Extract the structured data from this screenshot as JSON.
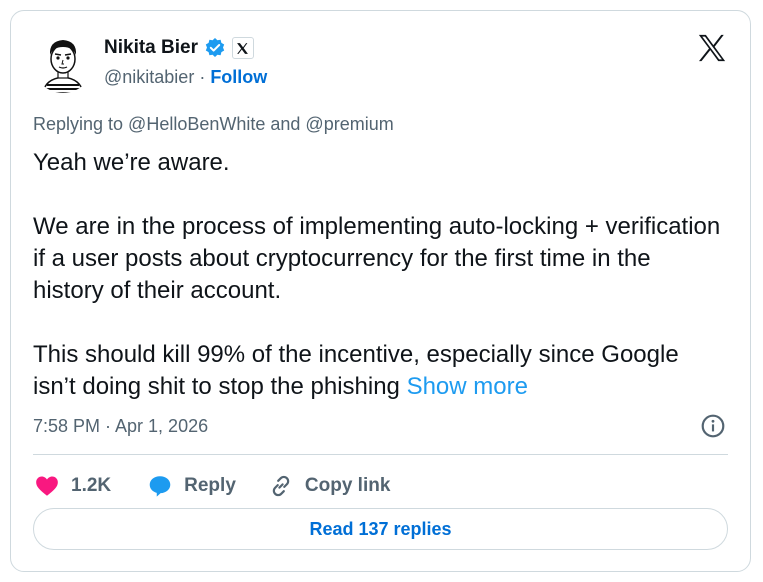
{
  "author": {
    "name": "Nikita Bier",
    "handle": "@nikitabier",
    "follow_label": "Follow",
    "separator": "·",
    "avatar_icon": "cartoon-portrait-avatar",
    "verified_icon": "verified-badge-icon",
    "affiliation_icon": "x-affiliation-badge-icon"
  },
  "header": {
    "logo_icon": "x-logo-icon"
  },
  "tweet": {
    "reply_to": "Replying to @HelloBenWhite and @premium",
    "paragraphs": [
      "Yeah we’re aware.",
      "We are in the process of implementing auto-locking + verification if a user posts about cryptocurrency for the first time in the history of their account.",
      "This should kill 99% of the incentive, especially since Google isn’t doing shit to stop the phishing"
    ],
    "show_more_label": "Show more",
    "timestamp": "7:58 PM · Apr 1, 2026"
  },
  "actions": {
    "like_count": "1.2K",
    "reply_label": "Reply",
    "copy_link_label": "Copy link"
  },
  "read_replies_label": "Read 137 replies",
  "colors": {
    "link_blue": "#006fd6",
    "show_more_blue": "#1d9bf0",
    "heart_pink": "#f91880",
    "verified_blue": "#1d9bf0",
    "muted_text": "#536471",
    "border": "#cfd9de"
  }
}
